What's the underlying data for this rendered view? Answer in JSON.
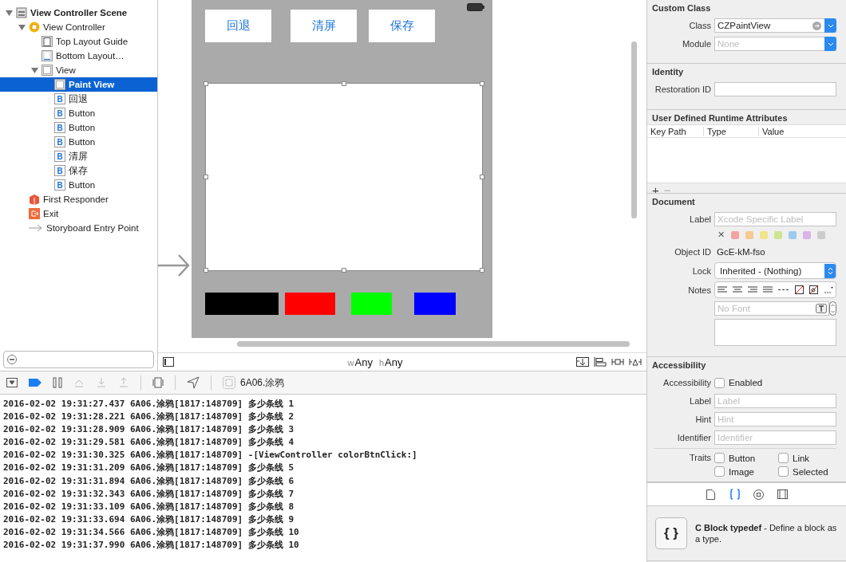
{
  "outline": {
    "items": [
      {
        "label": "View Controller Scene",
        "kind": "scene",
        "expanded": true,
        "selected": false,
        "children": [
          {
            "label": "View Controller",
            "kind": "controller",
            "expanded": true,
            "selected": false,
            "children": [
              {
                "label": "Top Layout Guide",
                "kind": "top-guide",
                "selected": false
              },
              {
                "label": "Bottom Layout…",
                "kind": "bottom-guide",
                "selected": false
              },
              {
                "label": "View",
                "kind": "view",
                "expanded": true,
                "selected": false,
                "children": [
                  {
                    "label": "Paint View",
                    "kind": "view",
                    "selected": true
                  },
                  {
                    "label": "回退",
                    "kind": "button",
                    "icon_text": "B",
                    "selected": false
                  },
                  {
                    "label": "Button",
                    "kind": "button",
                    "icon_text": "B",
                    "selected": false
                  },
                  {
                    "label": "Button",
                    "kind": "button",
                    "icon_text": "B",
                    "selected": false
                  },
                  {
                    "label": "Button",
                    "kind": "button",
                    "icon_text": "B",
                    "selected": false
                  },
                  {
                    "label": "清屏",
                    "kind": "button",
                    "icon_text": "B",
                    "selected": false
                  },
                  {
                    "label": "保存",
                    "kind": "button",
                    "icon_text": "B",
                    "selected": false
                  },
                  {
                    "label": "Button",
                    "kind": "button",
                    "icon_text": "B",
                    "selected": false
                  }
                ]
              }
            ]
          },
          {
            "label": "First Responder",
            "kind": "responder",
            "selected": false
          },
          {
            "label": "Exit",
            "kind": "exit",
            "selected": false
          },
          {
            "label": "Storyboard Entry Point",
            "kind": "entry",
            "selected": false
          }
        ]
      }
    ]
  },
  "canvas": {
    "top_buttons": [
      "回退",
      "清屏",
      "保存"
    ],
    "paint_view": {
      "selected": true
    },
    "color_buttons": [
      {
        "color": "#000000"
      },
      {
        "color": "#ff0000"
      },
      {
        "color": "#00ff00"
      },
      {
        "color": "#0000ff"
      }
    ],
    "size_class": {
      "w_prefix": "w",
      "w": "Any",
      "h_prefix": "h",
      "h": "Any"
    }
  },
  "debug_bar": {
    "breakpoints_active": true,
    "target": "6A06.涂鸦"
  },
  "console": [
    "2016-02-02 19:31:27.437 6A06.涂鸦[1817:148709] 多少条线 1",
    "2016-02-02 19:31:28.221 6A06.涂鸦[1817:148709] 多少条线 2",
    "2016-02-02 19:31:28.909 6A06.涂鸦[1817:148709] 多少条线 3",
    "2016-02-02 19:31:29.581 6A06.涂鸦[1817:148709] 多少条线 4",
    "2016-02-02 19:31:30.325 6A06.涂鸦[1817:148709] -[ViewController colorBtnClick:]",
    "2016-02-02 19:31:31.209 6A06.涂鸦[1817:148709] 多少条线 5",
    "2016-02-02 19:31:31.894 6A06.涂鸦[1817:148709] 多少条线 6",
    "2016-02-02 19:31:32.343 6A06.涂鸦[1817:148709] 多少条线 7",
    "2016-02-02 19:31:33.109 6A06.涂鸦[1817:148709] 多少条线 8",
    "2016-02-02 19:31:33.694 6A06.涂鸦[1817:148709] 多少条线 9",
    "2016-02-02 19:31:34.566 6A06.涂鸦[1817:148709] 多少条线 10",
    "2016-02-02 19:31:37.990 6A06.涂鸦[1817:148709] 多少条线 10"
  ],
  "inspector": {
    "custom_class": {
      "title": "Custom Class",
      "class_label": "Class",
      "class_value": "CZPaintView",
      "module_label": "Module",
      "module_placeholder": "None"
    },
    "identity": {
      "title": "Identity",
      "restoration_label": "Restoration ID"
    },
    "runtime_attributes": {
      "title": "User Defined Runtime Attributes",
      "columns": [
        "Key Path",
        "Type",
        "Value"
      ],
      "add": "+",
      "remove": "−"
    },
    "document": {
      "title": "Document",
      "label_label": "Label",
      "label_placeholder": "Xcode Specific Label",
      "clear": "✕",
      "swatches": [
        {
          "color": "#f4a3a3"
        },
        {
          "color": "#f5c98f"
        },
        {
          "color": "#f3e38a"
        },
        {
          "color": "#cde590"
        },
        {
          "color": "#9ccbf0"
        },
        {
          "color": "#d8b5e8"
        },
        {
          "color": "#cccccc"
        }
      ],
      "object_id_label": "Object ID",
      "object_id": "GcE-kM-fso",
      "lock_label": "Lock",
      "lock_value": "Inherited - (Nothing)",
      "notes_label": "Notes",
      "font_placeholder": "No Font"
    },
    "accessibility": {
      "title": "Accessibility",
      "enabled_label": "Accessibility",
      "enabled_text": "Enabled",
      "enabled": false,
      "fields": [
        {
          "label": "Label",
          "placeholder": "Label"
        },
        {
          "label": "Hint",
          "placeholder": "Hint"
        },
        {
          "label": "Identifier",
          "placeholder": "Identifier"
        }
      ],
      "traits_label": "Traits",
      "traits": [
        {
          "label": "Button",
          "checked": false
        },
        {
          "label": "Link",
          "checked": false
        },
        {
          "label": "Image",
          "checked": false
        },
        {
          "label": "Selected",
          "checked": false
        }
      ]
    },
    "library": {
      "tabs": [
        {
          "kind": "file",
          "selected": false
        },
        {
          "kind": "braces",
          "selected": true
        },
        {
          "kind": "object",
          "selected": false
        },
        {
          "kind": "media",
          "selected": false
        }
      ],
      "item": {
        "icon": "{ }",
        "description": "**C Block typedef** - Define a block as a type."
      }
    }
  }
}
